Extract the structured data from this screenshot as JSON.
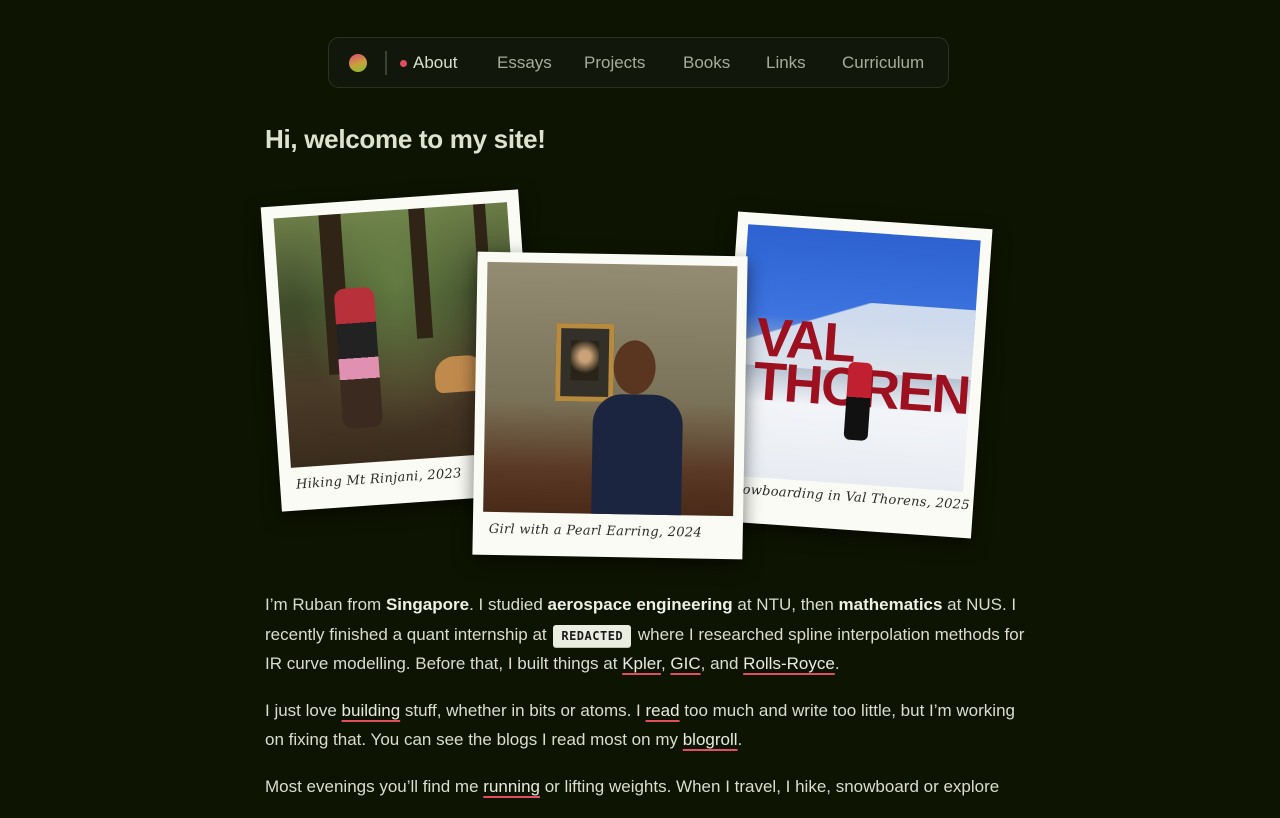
{
  "nav": {
    "items": [
      {
        "label": "About",
        "active": true
      },
      {
        "label": "Essays"
      },
      {
        "label": "Projects"
      },
      {
        "label": "Books"
      },
      {
        "label": "Links"
      },
      {
        "label": "Curriculum"
      }
    ]
  },
  "heading": "Hi, welcome to my site!",
  "photos": {
    "p1_caption": "Hiking Mt Rinjani, 2023",
    "p2_caption": "Girl with a Pearl Earring, 2024",
    "p3_caption": "Snowboarding in Val Thorens, 2025",
    "p3_sign": "VAL THORENS"
  },
  "intro": {
    "t1": "I’m Ruban from ",
    "b1": "Singapore",
    "t2": ". I studied ",
    "b2": "aerospace engineering",
    "t3": " at NTU, then ",
    "b3": "mathematics",
    "t4": " at NUS. I recently finished a quant internship at ",
    "redacted": "REDACTED",
    "t5": " where I researched spline interpolation methods for IR curve modelling. Before that, I built things at ",
    "l1": "Kpler",
    "t6": ", ",
    "l2": "GIC",
    "t7": ", and ",
    "l3": "Rolls-Royce",
    "t8": "."
  },
  "para2": {
    "t1": "I just love ",
    "l1": "building",
    "t2": " stuff, whether in bits or atoms. I ",
    "l2": "read",
    "t3": " too much and write too little, but I’m working on fixing that. You can see the blogs I read most on my ",
    "l3": "blogroll",
    "t4": "."
  },
  "para3": {
    "t1": "Most evenings you’ll find me ",
    "l1": "running",
    "t2": " or lifting weights. When I travel, I hike, snowboard or explore"
  },
  "colors": {
    "background": "#0e1402",
    "accent": "#e0505a"
  }
}
